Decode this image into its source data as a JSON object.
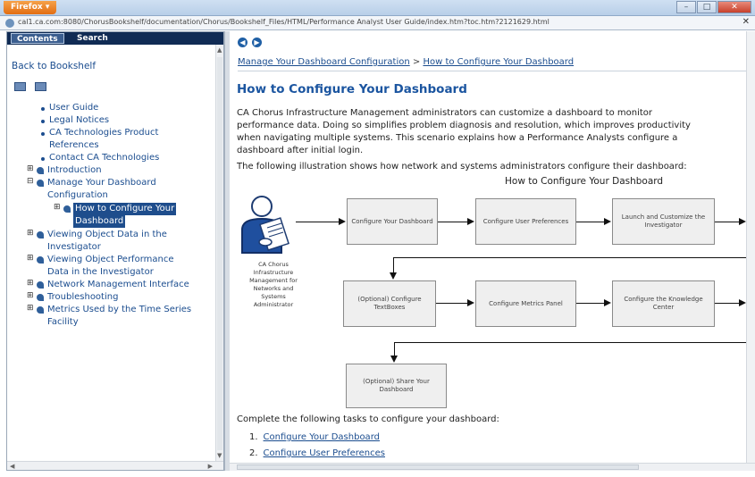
{
  "browser": {
    "menu_button": "Firefox ▾",
    "url": "cal1.ca.com:8080/ChorusBookshelf/documentation/Chorus/Bookshelf_Files/HTML/Performance Analyst User Guide/index.htm?toc.htm?2121629.html"
  },
  "left_pane": {
    "tabs": [
      "Contents",
      "Search"
    ],
    "back_link": "Back to Bookshelf",
    "toc": {
      "user_guide": "User Guide",
      "legal_notices": "Legal Notices",
      "ca_tech_line1": "CA Technologies Product",
      "ca_tech_line2": "References",
      "contact": "Contact CA Technologies",
      "introduction": "Introduction",
      "manage_line1": "Manage Your Dashboard",
      "manage_line2": "Configuration",
      "how_to_line1": "How to Configure Your",
      "how_to_line2": "Dashboard",
      "viewing_line1": "Viewing Object Data in the",
      "viewing_line2": "Investigator",
      "viewing_perf_line1": "Viewing Object Performance",
      "viewing_perf_line2": "Data in the Investigator",
      "network": "Network Management Interface",
      "troubleshooting": "Troubleshooting",
      "metrics_line1": "Metrics Used by the Time Series",
      "metrics_line2": "Facility"
    }
  },
  "right_pane": {
    "breadcrumb": {
      "part1": "Manage Your Dashboard Configuration",
      "separator": ">",
      "part2": "How to Configure Your Dashboard"
    },
    "title": "How to Configure Your Dashboard",
    "para1_line1": "CA Chorus Infrastructure Management administrators can customize a dashboard to monitor",
    "para1_line2": "performance data. Doing so simplifies problem diagnosis and resolution, which improves productivity",
    "para1_line3": "when navigating multiple systems. This scenario explains how a Performance Analysts configure a",
    "para1_line4": "dashboard after initial login.",
    "para2": "The following illustration shows how network and systems administrators configure their dashboard:",
    "illustration": {
      "title": "How to Configure Your Dashboard",
      "admin_label": "CA Chorus Infrastructure Management for Networks and Systems Administrator",
      "steps": [
        "Configure Your Dashboard",
        "Configure User Preferences",
        "Launch and Customize the Investigator",
        "(Optional) Configure TextBoxes",
        "Configure Metrics Panel",
        "Configure the Knowledge Center",
        "(Optional) Share Your Dashboard"
      ]
    },
    "tasks_intro": "Complete the following tasks to configure your dashboard:",
    "tasks": [
      {
        "num": "1.",
        "label": "Configure Your Dashboard"
      },
      {
        "num": "2.",
        "label": "Configure User Preferences"
      }
    ]
  }
}
